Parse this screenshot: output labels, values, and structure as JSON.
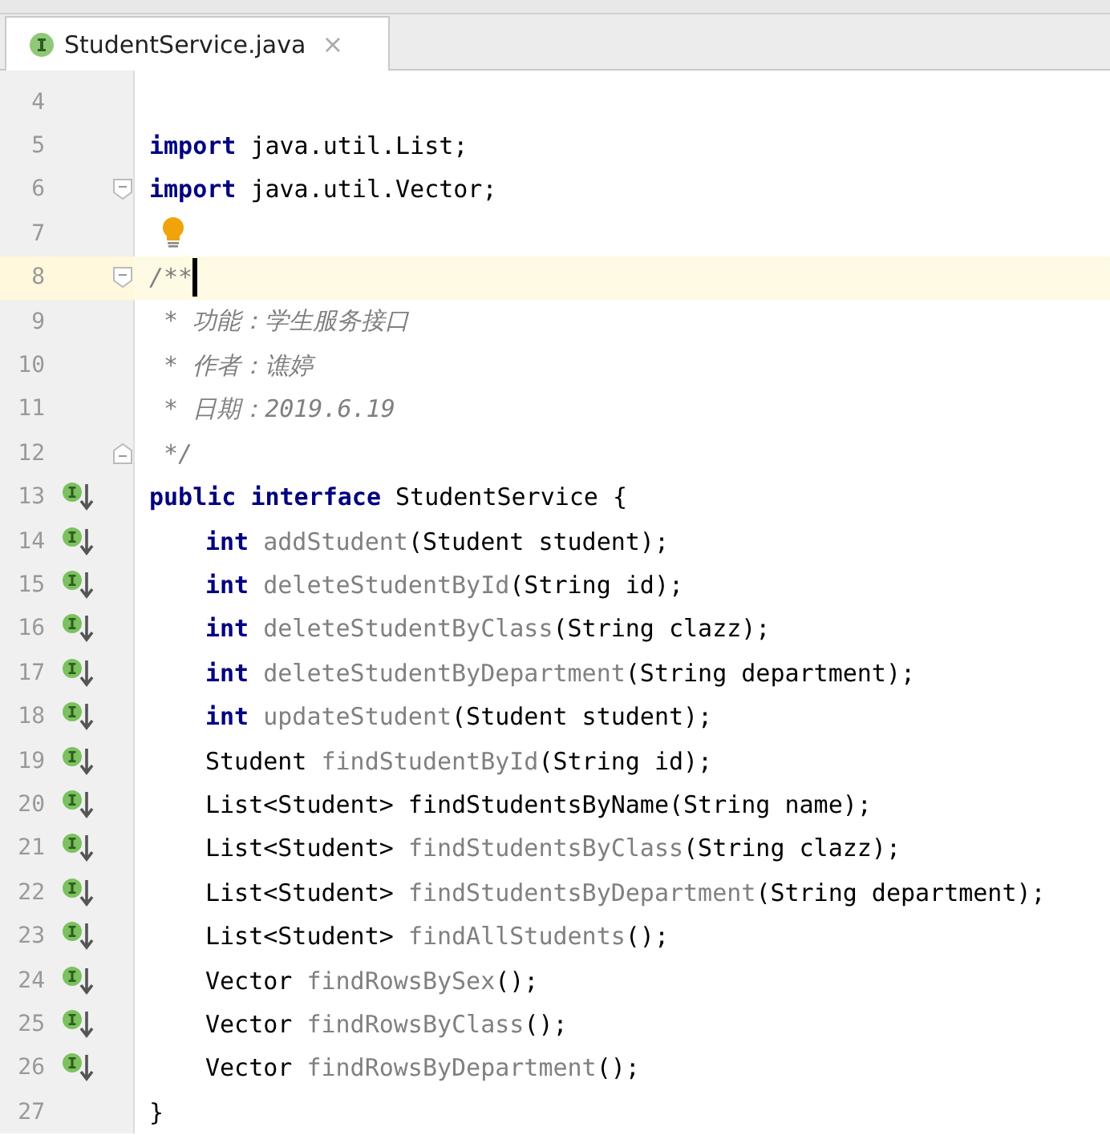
{
  "tab": {
    "title": "StudentService.java",
    "close": "×",
    "selected": true
  },
  "lines": [
    {
      "number": "4"
    },
    {
      "number": "5",
      "tokens": [
        {
          "text": "import ",
          "kind": "keyword"
        },
        {
          "text": "java.util.List;",
          "kind": "plain"
        }
      ]
    },
    {
      "number": "6",
      "fold_start": true,
      "tokens": [
        {
          "text": "import ",
          "kind": "keyword"
        },
        {
          "text": "java.util.Vector;",
          "kind": "plain"
        }
      ]
    },
    {
      "number": "7",
      "bulb": true
    },
    {
      "number": "8",
      "fold_start": true,
      "current": true,
      "tokens": [
        {
          "text": "/**",
          "kind": "comment"
        }
      ]
    },
    {
      "number": "9",
      "tokens": [
        {
          "text": " * 功能：学生服务接口",
          "kind": "comment"
        }
      ]
    },
    {
      "number": "10",
      "tokens": [
        {
          "text": " * 作者：谯婷",
          "kind": "comment"
        }
      ]
    },
    {
      "number": "11",
      "tokens": [
        {
          "text": " * 日期：2019.6.19",
          "kind": "comment"
        }
      ]
    },
    {
      "number": "12",
      "fold_end": true,
      "tokens": [
        {
          "text": " */",
          "kind": "comment"
        }
      ]
    },
    {
      "number": "13",
      "implemented": true,
      "tokens": [
        {
          "text": "public interface ",
          "kind": "keyword"
        },
        {
          "text": "StudentService {",
          "kind": "plain"
        }
      ]
    },
    {
      "number": "14",
      "implemented": true,
      "indented": true,
      "tokens": [
        {
          "text": "int ",
          "kind": "keyword"
        },
        {
          "text": "addStudent",
          "kind": "unused"
        },
        {
          "text": "(Student student);",
          "kind": "plain"
        }
      ]
    },
    {
      "number": "15",
      "implemented": true,
      "indented": true,
      "tokens": [
        {
          "text": "int ",
          "kind": "keyword"
        },
        {
          "text": "deleteStudentById",
          "kind": "unused"
        },
        {
          "text": "(String id);",
          "kind": "plain"
        }
      ]
    },
    {
      "number": "16",
      "implemented": true,
      "indented": true,
      "tokens": [
        {
          "text": "int ",
          "kind": "keyword"
        },
        {
          "text": "deleteStudentByClass",
          "kind": "unused"
        },
        {
          "text": "(String clazz);",
          "kind": "plain"
        }
      ]
    },
    {
      "number": "17",
      "implemented": true,
      "indented": true,
      "tokens": [
        {
          "text": "int ",
          "kind": "keyword"
        },
        {
          "text": "deleteStudentByDepartment",
          "kind": "unused"
        },
        {
          "text": "(String department);",
          "kind": "plain"
        }
      ]
    },
    {
      "number": "18",
      "implemented": true,
      "indented": true,
      "tokens": [
        {
          "text": "int ",
          "kind": "keyword"
        },
        {
          "text": "updateStudent",
          "kind": "unused"
        },
        {
          "text": "(Student student);",
          "kind": "plain"
        }
      ]
    },
    {
      "number": "19",
      "implemented": true,
      "indented": true,
      "tokens": [
        {
          "text": "Student ",
          "kind": "plain"
        },
        {
          "text": "findStudentById",
          "kind": "unused"
        },
        {
          "text": "(String id);",
          "kind": "plain"
        }
      ]
    },
    {
      "number": "20",
      "implemented": true,
      "indented": true,
      "tokens": [
        {
          "text": "List<Student> findStudentsByName(String name);",
          "kind": "plain"
        }
      ]
    },
    {
      "number": "21",
      "implemented": true,
      "indented": true,
      "tokens": [
        {
          "text": "List<Student> ",
          "kind": "plain"
        },
        {
          "text": "findStudentsByClass",
          "kind": "unused"
        },
        {
          "text": "(String clazz);",
          "kind": "plain"
        }
      ]
    },
    {
      "number": "22",
      "implemented": true,
      "indented": true,
      "tokens": [
        {
          "text": "List<Student> ",
          "kind": "plain"
        },
        {
          "text": "findStudentsByDepartment",
          "kind": "unused"
        },
        {
          "text": "(String department);",
          "kind": "plain"
        }
      ]
    },
    {
      "number": "23",
      "implemented": true,
      "indented": true,
      "tokens": [
        {
          "text": "List<Student> ",
          "kind": "plain"
        },
        {
          "text": "findAllStudents",
          "kind": "unused"
        },
        {
          "text": "();",
          "kind": "plain"
        }
      ]
    },
    {
      "number": "24",
      "implemented": true,
      "indented": true,
      "tokens": [
        {
          "text": "Vector ",
          "kind": "plain"
        },
        {
          "text": "findRowsBySex",
          "kind": "unused"
        },
        {
          "text": "();",
          "kind": "plain"
        }
      ]
    },
    {
      "number": "25",
      "implemented": true,
      "indented": true,
      "tokens": [
        {
          "text": "Vector ",
          "kind": "plain"
        },
        {
          "text": "findRowsByClass",
          "kind": "unused"
        },
        {
          "text": "();",
          "kind": "plain"
        }
      ]
    },
    {
      "number": "26",
      "implemented": true,
      "indented": true,
      "tokens": [
        {
          "text": "Vector ",
          "kind": "plain"
        },
        {
          "text": "findRowsByDepartment",
          "kind": "unused"
        },
        {
          "text": "();",
          "kind": "plain"
        }
      ]
    },
    {
      "number": "27",
      "tokens": [
        {
          "text": "}",
          "kind": "plain"
        }
      ]
    }
  ]
}
